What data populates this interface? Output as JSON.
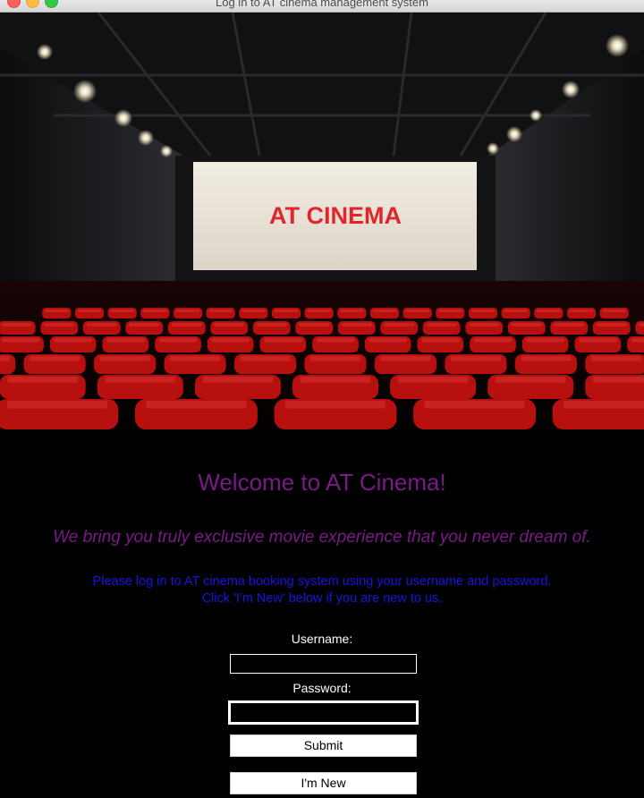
{
  "window": {
    "title": "Log in to AT cinema management system"
  },
  "hero": {
    "screen_text": "AT CINEMA"
  },
  "welcome": "Welcome to AT Cinema!",
  "tagline": "We bring you truly exclusive movie experience that you never dream of.",
  "instructions": [
    "Please log in to AT cinema booking system using your username and password.",
    "Click 'I'm New' below if you are new to us."
  ],
  "form": {
    "username_label": "Username:",
    "username_value": "",
    "password_label": "Password:",
    "password_value": "",
    "submit_label": "Submit",
    "new_label": "I'm New"
  },
  "colors": {
    "welcome": "#7a1a86",
    "instructions": "#1515e0",
    "screen_text": "#e0262b",
    "seat": "#b8100f",
    "background": "#000000"
  }
}
